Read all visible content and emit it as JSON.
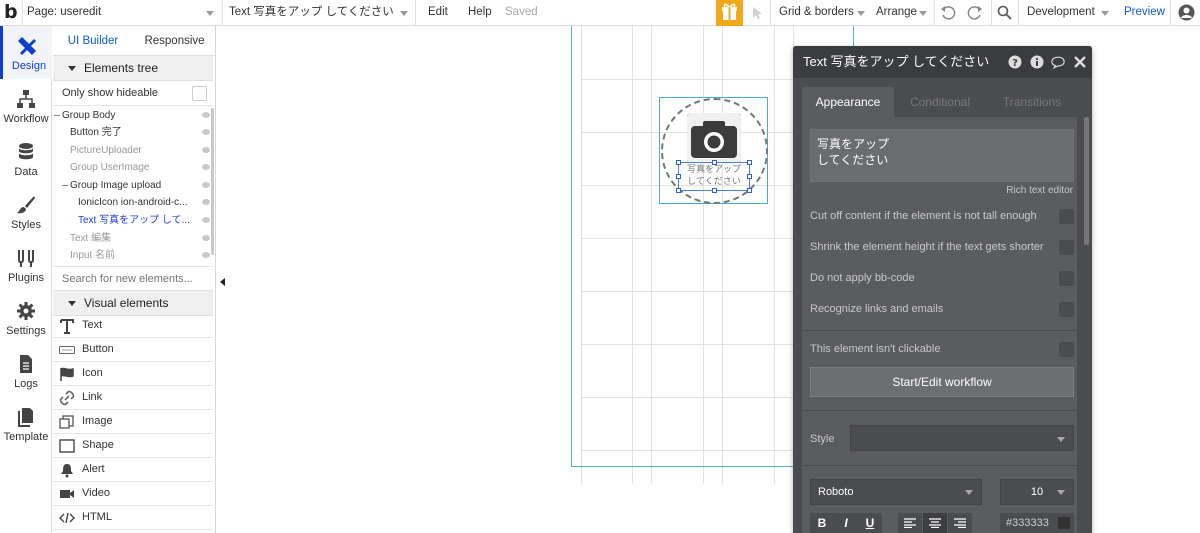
{
  "topbar": {
    "logo": "b",
    "page_label": "Page: useredit",
    "element_label": "Text 写真をアップ してください",
    "edit": "Edit",
    "help": "Help",
    "saved": "Saved",
    "grid_borders": "Grid & borders",
    "arrange": "Arrange",
    "environment": "Development",
    "preview": "Preview",
    "accent_color": "#f2a818"
  },
  "rail": {
    "items": [
      {
        "label": "Design",
        "icon": "design-icon"
      },
      {
        "label": "Workflow",
        "icon": "workflow-icon"
      },
      {
        "label": "Data",
        "icon": "database-icon"
      },
      {
        "label": "Styles",
        "icon": "brush-icon"
      },
      {
        "label": "Plugins",
        "icon": "plug-icon"
      },
      {
        "label": "Settings",
        "icon": "gear-icon"
      },
      {
        "label": "Logs",
        "icon": "document-icon"
      },
      {
        "label": "Template",
        "icon": "template-icon"
      }
    ]
  },
  "panel": {
    "tab_builder": "UI Builder",
    "tab_responsive": "Responsive",
    "elements_tree": "Elements tree",
    "only_hideable": "Only show hideable",
    "tree": [
      {
        "label": "Group Body"
      },
      {
        "label": "Button 完了"
      },
      {
        "label": "PictureUploader"
      },
      {
        "label": "Group UserImage"
      },
      {
        "label": "Group Image upload"
      },
      {
        "label": "IonicIcon ion-android-c..."
      },
      {
        "label": "Text 写真をアップ して..."
      },
      {
        "label": "Text 編集"
      },
      {
        "label": "Input 名前"
      }
    ],
    "search_placeholder": "Search for new elements...",
    "visual_elements": "Visual elements",
    "visual": [
      {
        "label": "Text"
      },
      {
        "label": "Button"
      },
      {
        "label": "Icon"
      },
      {
        "label": "Link"
      },
      {
        "label": "Image"
      },
      {
        "label": "Shape"
      },
      {
        "label": "Alert"
      },
      {
        "label": "Video"
      },
      {
        "label": "HTML"
      }
    ]
  },
  "canvas": {
    "upload_text": "写真をアップ\nしてください"
  },
  "editor": {
    "title": "Text 写真をアップ してください",
    "tabs": {
      "appearance": "Appearance",
      "conditional": "Conditional",
      "transitions": "Transitions"
    },
    "content": "写真をアップ\nしてください",
    "rich_text_editor": "Rich text editor",
    "options": [
      "Cut off content if the element is not tall enough",
      "Shrink the element height if the text gets shorter",
      "Do not apply bb-code",
      "Recognize links and emails"
    ],
    "not_clickable": "This element isn't clickable",
    "workflow_button": "Start/Edit workflow",
    "style_label": "Style",
    "font": "Roboto",
    "font_size": "10",
    "color": "#333333",
    "fmt": {
      "bold": "B",
      "italic": "I",
      "underline": "U"
    }
  }
}
